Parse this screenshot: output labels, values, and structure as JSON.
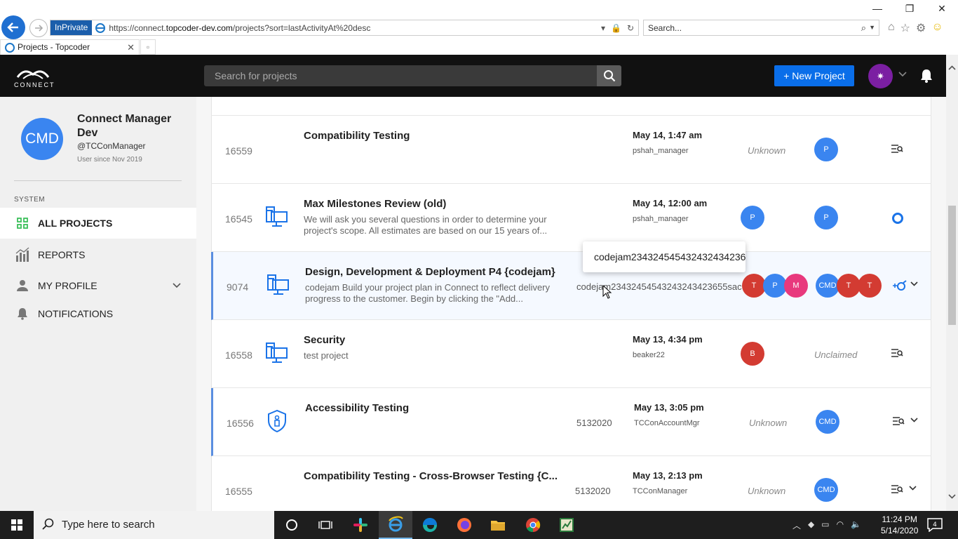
{
  "browser": {
    "inprivate_label": "InPrivate",
    "url_prefix": "https://connect.",
    "url_domain": "topcoder-dev.com",
    "url_path": "/projects?sort=lastActivityAt%20desc",
    "search_placeholder": "Search...",
    "tab_title": "Projects - Topcoder"
  },
  "header": {
    "logo_text": "CONNECT",
    "search_placeholder": "Search for projects",
    "new_project_label": "+ New Project",
    "user_avatar_glyph": "✷"
  },
  "sidebar": {
    "avatar_initials": "CMD",
    "name": "Connect Manager Dev",
    "handle": "@TCConManager",
    "since": "User since Nov 2019",
    "section": "SYSTEM",
    "items": [
      {
        "label": "ALL PROJECTS",
        "icon": "grid-icon"
      },
      {
        "label": "REPORTS",
        "icon": "chart-icon"
      },
      {
        "label": "MY PROFILE",
        "icon": "person-icon"
      },
      {
        "label": "NOTIFICATIONS",
        "icon": "bell-icon"
      }
    ]
  },
  "projects": [
    {
      "id": "16559",
      "title": "Compatibility Testing",
      "desc": "",
      "ref": "",
      "date": "May 14, 1:47 am",
      "user": "pshah_manager",
      "left_status": "Unknown",
      "left_avatars": [],
      "right_avatars": [
        "P"
      ],
      "right_status": ""
    },
    {
      "id": "16545",
      "title": "Max Milestones Review (old)",
      "desc": "We will ask you several questions in order to determine your project's scope. All estimates are based on our 15 years of...",
      "ref": "",
      "date": "May 14, 12:00 am",
      "user": "pshah_manager",
      "left_status": "",
      "left_avatars": [
        "P"
      ],
      "right_avatars": [
        "P"
      ],
      "right_status": ""
    },
    {
      "id": "9074",
      "title": "Design, Development & Deployment P4 {codejam}",
      "desc": "codejam Build your project plan in Connect to reflect delivery progress to the customer. Begin by clicking the \"Add...",
      "ref": "codejam23432454543243243423655sac",
      "date": "",
      "user": "",
      "left_status": "",
      "left_avatars": [
        "T",
        "P",
        "M"
      ],
      "right_avatars": [
        "CMD",
        "T",
        "T"
      ],
      "right_status": ""
    },
    {
      "id": "16558",
      "title": "Security",
      "desc": "test project",
      "ref": "",
      "date": "May 13, 4:34 pm",
      "user": "beaker22",
      "left_status": "",
      "left_avatars": [
        "B"
      ],
      "right_avatars": [],
      "right_status": "Unclaimed"
    },
    {
      "id": "16556",
      "title": "Accessibility Testing",
      "desc": "",
      "ref": "5132020",
      "date": "May 13, 3:05 pm",
      "user": "TCConAccountMgr",
      "left_status": "Unknown",
      "left_avatars": [],
      "right_avatars": [
        "CMD"
      ],
      "right_status": ""
    },
    {
      "id": "16555",
      "title": "Compatibility Testing - Cross-Browser Testing {C...",
      "desc": "",
      "ref": "5132020",
      "date": "May 13, 2:13 pm",
      "user": "TCConManager",
      "left_status": "Unknown",
      "left_avatars": [],
      "right_avatars": [
        "CMD"
      ],
      "right_status": ""
    }
  ],
  "tooltip": "codejam23432454543243243423655sac",
  "taskbar": {
    "search_placeholder": "Type here to search",
    "time": "11:24 PM",
    "date": "5/14/2020",
    "notif_count": "4"
  },
  "colors": {
    "accent_blue": "#0a6ee9",
    "avatar_blue": "#3a85f0",
    "avatar_red": "#d33b32",
    "avatar_pink": "#e8397d",
    "user_purple": "#7b1fa2"
  }
}
